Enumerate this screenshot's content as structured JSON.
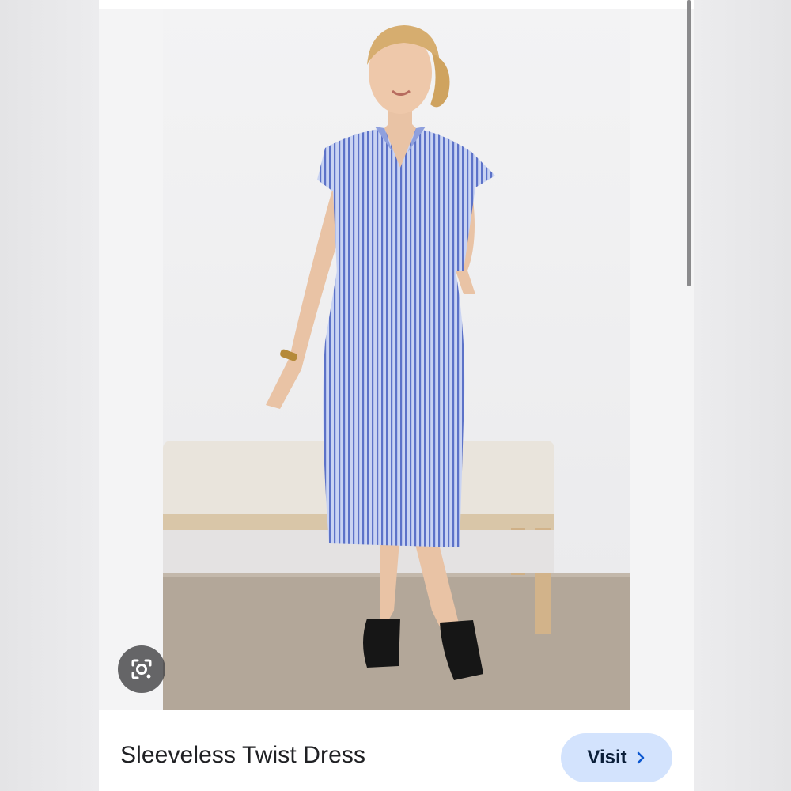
{
  "product": {
    "title": "Sleeveless Twist Dress"
  },
  "actions": {
    "visit_label": "Visit",
    "visit_icon": "chevron-right-icon",
    "lens_icon": "google-lens-icon"
  },
  "colors": {
    "accent_button_bg": "#d3e3fd",
    "lens_button_bg": "#46464a"
  }
}
